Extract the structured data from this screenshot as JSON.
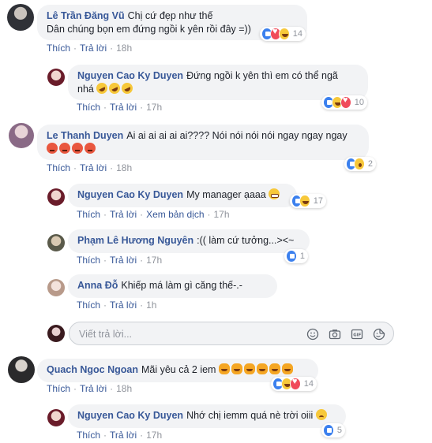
{
  "actions": {
    "like": "Thích",
    "reply": "Trả lời",
    "see_translation": "Xem bản dịch",
    "dot": "·"
  },
  "comments": [
    {
      "author": "Lê Trần Đăng Vũ",
      "text": "Chị cứ đẹp như thế",
      "text2": "Dân chúng bọn em đứng ngồi k yên rồi đây =))",
      "time": "18h",
      "reactions": [
        "like",
        "love",
        "haha"
      ],
      "count": "14"
    },
    {
      "author": "Nguyen Cao Ky Duyen",
      "text": "Đứng ngồi k yên thì em có thể ngã",
      "text2": "nhá",
      "emojis": 3,
      "time": "17h",
      "reactions": [
        "like",
        "haha",
        "love"
      ],
      "count": "10"
    },
    {
      "author": "Le Thanh Duyen",
      "text": "Ai ai ai ai ai ai???? Nói nói nói nói ngay ngay ngay",
      "emojis": 4,
      "time": "18h",
      "reactions": [
        "like",
        "wow"
      ],
      "count": "2"
    },
    {
      "author": "Nguyen Cao Ky Duyen",
      "text": "My manager ạaaa",
      "time": "17h",
      "reactions": [
        "like",
        "haha"
      ],
      "count": "17"
    },
    {
      "author": "Phạm Lê Hương Nguyên",
      "text": ":(( làm cứ tưởng...><~",
      "time": "17h",
      "reactions": [
        "like"
      ],
      "count": "1"
    },
    {
      "author": "Anna Đỗ",
      "text": "Khiếp má làm gì căng thế-.-",
      "time": "1h"
    },
    {
      "author": "Quach Ngoc Ngoan",
      "text": "Mãi yêu cả 2 iem",
      "emojis": 6,
      "time": "18h",
      "reactions": [
        "like",
        "haha",
        "love"
      ],
      "count": "14"
    },
    {
      "author": "Nguyen Cao Ky Duyen",
      "text": "Nhớ chị iemm quá nè trời oiii",
      "time": "17h",
      "reactions": [
        "like"
      ],
      "count": "5"
    }
  ],
  "reply_box": {
    "placeholder": "Viết trả lời..."
  },
  "reply_tools": [
    "emoji-icon",
    "camera-icon",
    "gif-icon",
    "sticker-icon"
  ],
  "colors": {
    "author": "#385898",
    "meta": "#90949c",
    "bubble": "#f2f3f5",
    "like": "#3b80ee",
    "love": "#f04b5a",
    "haha": "#f7c83a"
  }
}
